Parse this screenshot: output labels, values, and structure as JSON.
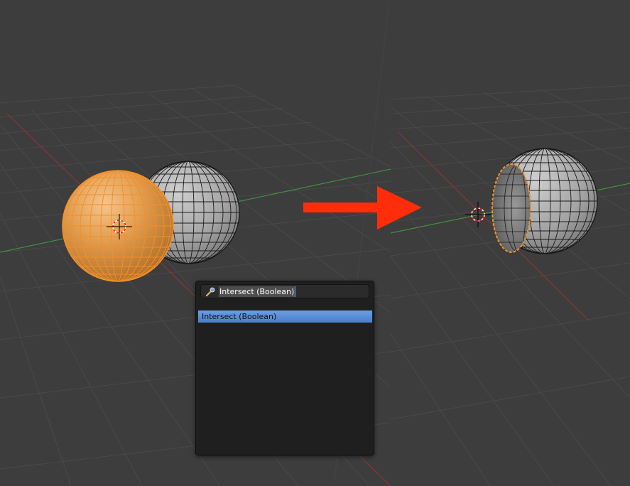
{
  "viewport": {
    "background": "#3d3d3d",
    "grid_color": "#4a4a4a",
    "x_axis_color": "#b03a3a",
    "y_axis_color": "#3f8f3f",
    "selection_color": "#f0902a",
    "arrow_color": "#ff2d0a",
    "objects": {
      "left": [
        "selected-orange-sphere",
        "grey-sphere"
      ],
      "right": [
        "result-grey-sphere-with-intersect-cut"
      ]
    },
    "icons": [
      "3d-cursor-icon",
      "arrow-right-icon"
    ]
  },
  "search": {
    "value": "Intersect (Boolean)",
    "icon": "search-icon"
  },
  "results": [
    {
      "label": "Intersect (Boolean)",
      "highlighted": true
    }
  ]
}
